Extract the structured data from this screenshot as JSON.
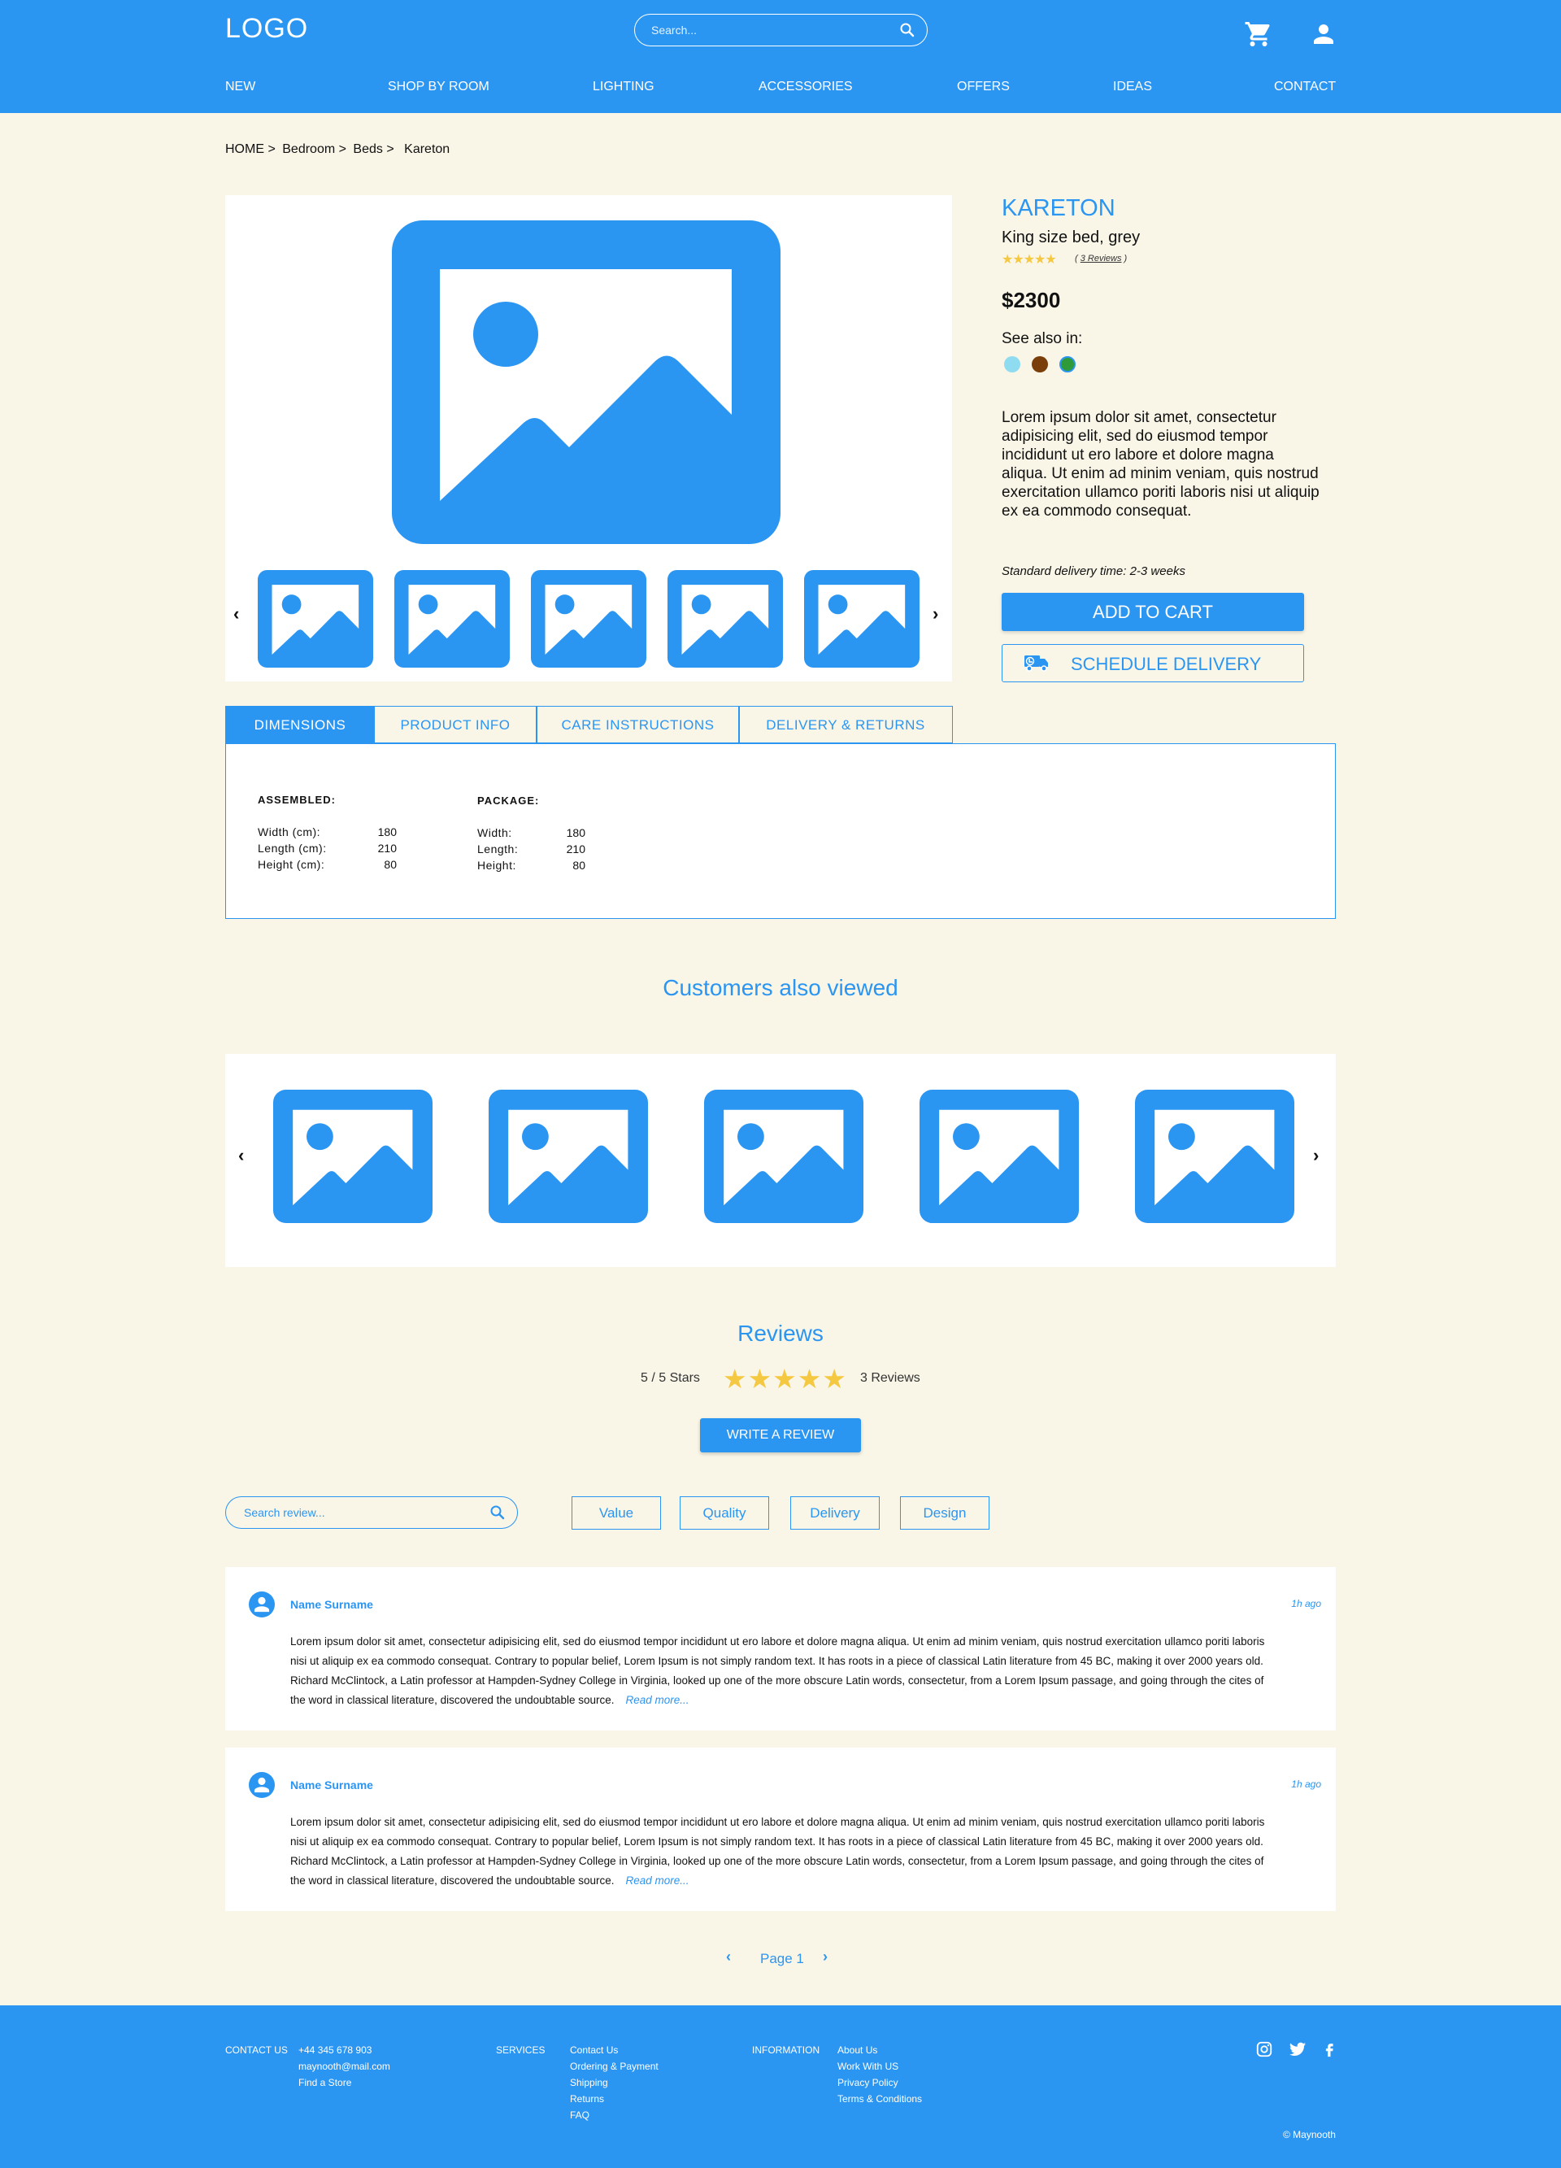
{
  "colors": {
    "primary": "#2b95f2",
    "background": "#f9f6e8",
    "star": "#f5c842"
  },
  "header": {
    "logo": "LOGO",
    "search_placeholder": "Search...",
    "nav": [
      "NEW",
      "SHOP BY ROOM",
      "LIGHTING",
      "ACCESSORIES",
      "OFFERS",
      "IDEAS",
      "CONTACT"
    ],
    "icons": [
      "search-icon",
      "cart-icon",
      "user-icon"
    ]
  },
  "breadcrumb": [
    "HOME >",
    "Bedroom >",
    "Beds >",
    "Kareton"
  ],
  "product": {
    "name": "KARETON",
    "subtitle": "King size bed, grey",
    "stars": "★★★★★",
    "rating": 5,
    "reviews_link": "3 Reviews",
    "price": "$2300",
    "see_also_label": "See also in:",
    "swatches": [
      "#8fdcf0",
      "#7a3e0a",
      "#2e9a3a"
    ],
    "description": "Lorem ipsum dolor sit amet, consectetur adipisicing elit, sed do eiusmod tempor incididunt ut ero labore et dolore magna aliqua. Ut enim ad minim veniam, quis nostrud exercitation ullamco poriti laboris nisi ut aliquip ex ea commodo consequat.",
    "delivery_time": "Standard delivery time: 2-3 weeks",
    "add_to_cart": "ADD TO CART",
    "schedule_delivery": "SCHEDULE DELIVERY"
  },
  "tabs": [
    "DIMENSIONS",
    "PRODUCT INFO",
    "CARE INSTRUCTIONS",
    "DELIVERY & RETURNS"
  ],
  "dimensions": {
    "assembled_title": "ASSEMBLED:",
    "assembled": [
      {
        "label": "Width (cm):",
        "value": "180"
      },
      {
        "label": "Length (cm):",
        "value": "210"
      },
      {
        "label": "Height (cm):",
        "value": "80"
      }
    ],
    "package_title": "PACKAGE:",
    "package": [
      {
        "label": "Width:",
        "value": "180"
      },
      {
        "label": "Length:",
        "value": "210"
      },
      {
        "label": "Height:",
        "value": "80"
      }
    ]
  },
  "customers_also_viewed": {
    "title": "Customers also viewed"
  },
  "reviews": {
    "title": "Reviews",
    "score": "5 / 5 Stars",
    "stars": "★★★★★",
    "count": "3 Reviews",
    "write_button": "WRITE A REVIEW",
    "search_placeholder": "Search review...",
    "filters": [
      "Value",
      "Quality",
      "Delivery",
      "Design"
    ],
    "items": [
      {
        "name": "Name Surname",
        "time": "1h ago",
        "body": "Lorem ipsum dolor sit amet, consectetur adipisicing elit, sed do eiusmod tempor incididunt ut ero labore et dolore magna aliqua. Ut enim ad minim veniam, quis nostrud exercitation ullamco poriti laboris nisi ut aliquip ex ea commodo consequat. Contrary to popular belief, Lorem Ipsum is not simply random text. It has roots in a piece of classical Latin literature from 45 BC, making it over 2000 years old. Richard McClintock, a Latin professor at Hampden-Sydney College in Virginia, looked up one of the more obscure Latin words, consectetur, from a Lorem Ipsum passage, and going through the cites of the word in classical literature, discovered the undoubtable source.",
        "more": "Read more..."
      },
      {
        "name": "Name Surname",
        "time": "1h ago",
        "body": "Lorem ipsum dolor sit amet, consectetur adipisicing elit, sed do eiusmod tempor incididunt ut ero labore et dolore magna aliqua. Ut enim ad minim veniam, quis nostrud exercitation ullamco poriti laboris nisi ut aliquip ex ea commodo consequat. Contrary to popular belief, Lorem Ipsum is not simply random text. It has roots in a piece of classical Latin literature from 45 BC, making it over 2000 years old. Richard McClintock, a Latin professor at Hampden-Sydney College in Virginia, looked up one of the more obscure Latin words, consectetur, from a Lorem Ipsum passage, and going through the cites of the word in classical literature, discovered the undoubtable source.",
        "more": "Read more..."
      }
    ],
    "pager": {
      "prev": "‹",
      "label": "Page 1",
      "next": "›"
    }
  },
  "footer": {
    "contact_head": "CONTACT US",
    "contact": [
      "+44 345 678 903",
      "maynooth@mail.com",
      "Find a Store"
    ],
    "services_head": "SERVICES",
    "services": [
      "Contact Us",
      "Ordering & Payment",
      "Shipping",
      "Returns",
      "FAQ"
    ],
    "info_head": "INFORMATION",
    "info": [
      "About Us",
      "Work With US",
      "Privacy Policy",
      "Terms & Conditions"
    ],
    "social": [
      "instagram-icon",
      "twitter-icon",
      "facebook-icon"
    ],
    "copyright": "© Maynooth"
  }
}
